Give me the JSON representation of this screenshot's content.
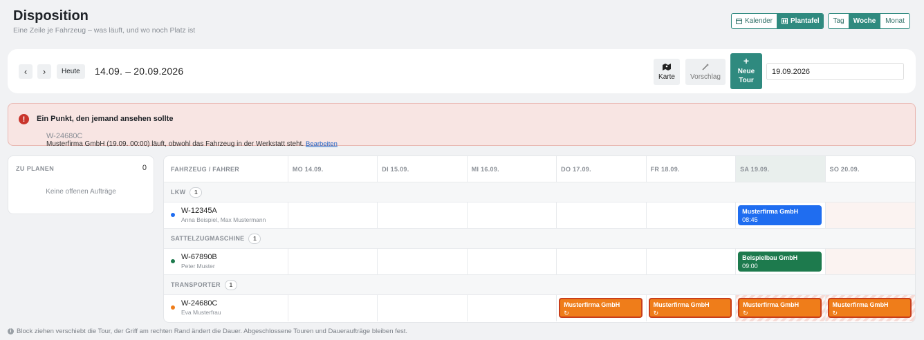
{
  "header": {
    "title": "Disposition",
    "subtitle": "Eine Zeile je Fahrzeug – was läuft, und wo noch Platz ist"
  },
  "view_toggle": {
    "kalender": "Kalender",
    "plantafel": "Plantafel",
    "active": "Plantafel"
  },
  "range_toggle": {
    "tag": "Tag",
    "woche": "Woche",
    "monat": "Monat",
    "active": "Woche"
  },
  "toolbar": {
    "prev_icon": "‹",
    "next_icon": "›",
    "today_label": "Heute",
    "date_range": "14.09. – 20.09.2026",
    "karte_label": "Karte",
    "vorschlag_label": "Vorschlag",
    "new_tour_plus": "+",
    "new_tour_line1": "Neue",
    "new_tour_line2": "Tour",
    "date_value": "19.09.2026"
  },
  "alert": {
    "title": "Ein Punkt, den jemand ansehen sollte",
    "plate": "W-24680C",
    "message": " Musterfirma GmbH (19.09. 00:00) läuft, obwohl das Fahrzeug in der Werkstatt steht. ",
    "link": "Bearbeiten",
    "color": "#c9352c"
  },
  "zu_planen": {
    "label": "ZU PLANEN",
    "count": "0",
    "empty": "Keine offenen Aufträge"
  },
  "grid": {
    "columns": [
      "FAHRZEUG / FAHRER",
      "MO 14.09.",
      "DI 15.09.",
      "MI 16.09.",
      "DO 17.09.",
      "FR 18.09.",
      "SA 19.09.",
      "SO 20.09."
    ],
    "groups": [
      {
        "name": "LKW",
        "count": "1",
        "vehicle": {
          "plate": "W-12345A",
          "driver": "Anna Beispiel, Max Mustermann",
          "dot_color": "#1f6df0"
        },
        "block": {
          "title": "Musterfirma GmbH",
          "time": "08:45",
          "color": "#1f6df0"
        }
      },
      {
        "name": "SATTELZUGMASCHINE",
        "count": "1",
        "vehicle": {
          "plate": "W-67890B",
          "driver": "Peter Muster",
          "dot_color": "#1d7a4d"
        },
        "block": {
          "title": "Beispielbau GmbH",
          "time": "09:00",
          "color": "#1d7a4d"
        }
      },
      {
        "name": "TRANSPORTER",
        "count": "1",
        "vehicle": {
          "plate": "W-24680C",
          "driver": "Eva Musterfrau",
          "dot_color": "#ef7d1a"
        },
        "block": {
          "title": "Musterfirma GmbH",
          "recurring_icon": "↻",
          "color": "#ef7d1a"
        }
      }
    ]
  },
  "footer": {
    "info_icon": "i",
    "text": "Block ziehen verschiebt die Tour, der Griff am rechten Rand ändert die Dauer. Abgeschlossene Touren und Daueraufträge bleiben fest."
  }
}
